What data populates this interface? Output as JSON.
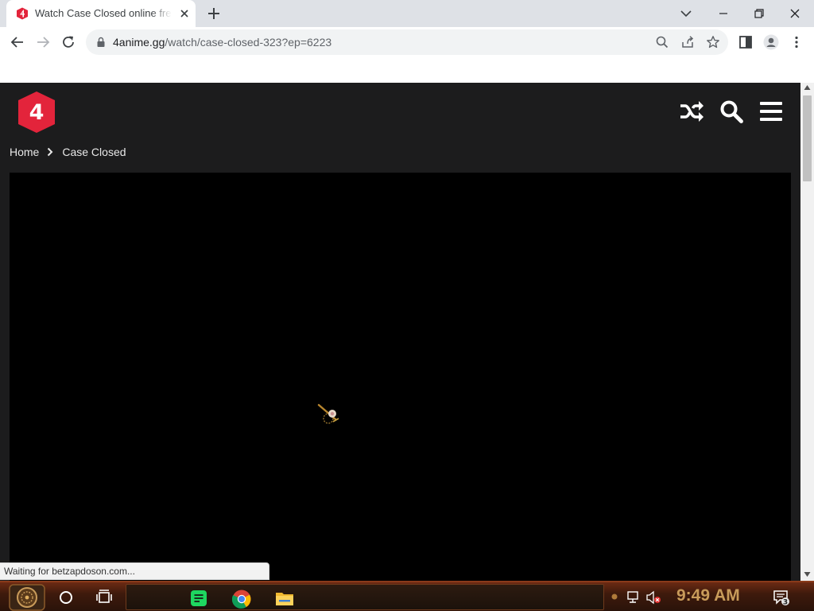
{
  "browser": {
    "tab": {
      "title": "Watch Case Closed online free"
    },
    "address": {
      "host": "4anime.gg",
      "path": "/watch/case-closed-323?ep=6223"
    },
    "status_text": "Waiting for betzapdoson.com..."
  },
  "site": {
    "logo_text": "4",
    "brand_color": "#e3243b",
    "breadcrumb": {
      "home": "Home",
      "current": "Case Closed"
    }
  },
  "taskbar": {
    "clock": "9:49 AM",
    "notification_count": "3",
    "accent": "#c89b5a"
  }
}
